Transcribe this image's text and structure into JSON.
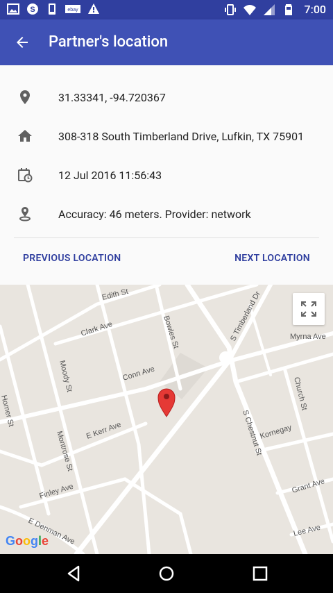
{
  "status_bar": {
    "time": "7:00",
    "left_icons": [
      "image-icon",
      "skype-icon",
      "phone-icon",
      "ebay-icon",
      "warning-icon"
    ],
    "right_icons": [
      "vibrate-icon",
      "wifi-icon",
      "signal-icon",
      "battery-icon"
    ]
  },
  "app_bar": {
    "title": "Partner's location",
    "back_icon": "arrow-back-icon"
  },
  "details": {
    "coordinates": "31.33341, -94.720367",
    "address": "308-318 South Timberland Drive, Lufkin, TX 75901",
    "timestamp": "12 Jul 2016 11:56:43",
    "accuracy": "Accuracy: 46 meters. Provider: network"
  },
  "actions": {
    "previous": "PREVIOUS LOCATION",
    "next": "NEXT LOCATION"
  },
  "map": {
    "streets": [
      "Edith St",
      "Clark Ave",
      "Bowles St",
      "S Timberland Dr",
      "Myrna Ave",
      "Moody St",
      "Conn Ave",
      "Church St",
      "Homer St",
      "E Kerr Ave",
      "S Chestnut St",
      "Kornegay",
      "Montrose St",
      "Grant Ave",
      "Finley Ave",
      "E Denman Ave",
      "Lee Ave"
    ],
    "attribution": "Google",
    "marker_color": "#e53935"
  },
  "colors": {
    "primary": "#3f51b5",
    "primary_dark": "#303f9f"
  }
}
